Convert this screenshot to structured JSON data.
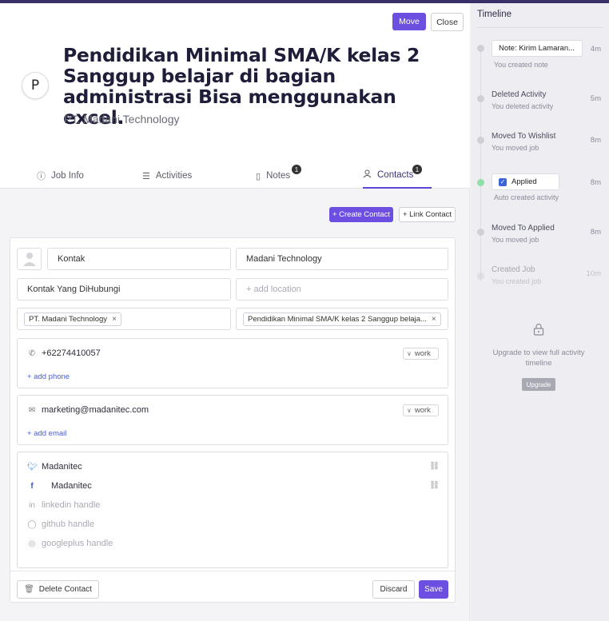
{
  "header": {
    "move_label": "Move",
    "close_label": "Close",
    "avatar_initial": "P",
    "job_title": "Pendidikan Minimal SMA/K kelas 2 Sanggup belajar di bagian administrasi Bisa menggunakan excel.",
    "company": "PT. Madani Technology"
  },
  "tabs": [
    {
      "label": "Job Info",
      "icon": "info-icon"
    },
    {
      "label": "Activities",
      "icon": "list-icon"
    },
    {
      "label": "Notes",
      "icon": "note-icon",
      "badge": "1"
    },
    {
      "label": "Contacts",
      "icon": "contacts-icon",
      "badge": "1",
      "active": true
    }
  ],
  "actions": {
    "create_contact": "+ Create Contact",
    "link_contact": "+ Link Contact"
  },
  "contact": {
    "name": "Kontak",
    "company": "Madani Technology",
    "title": "Kontak Yang DiHubungi",
    "location_placeholder": "+ add location",
    "company_tag": "PT. Madani Technology",
    "job_tag": "Pendidikan Minimal SMA/K kelas 2 Sanggup belaja...",
    "phone": "+62274410057",
    "phone_type": "work",
    "add_phone": "+ add phone",
    "email": "marketing@madanitec.com",
    "email_type": "work",
    "add_email": "+ add email",
    "twitter": "Madanitec",
    "facebook": "Madanitec",
    "linkedin_placeholder": "linkedin handle",
    "github_placeholder": "github handle",
    "googleplus_placeholder": "googleplus handle"
  },
  "footer": {
    "delete_label": "Delete Contact",
    "discard_label": "Discard",
    "save_label": "Save"
  },
  "timeline": {
    "title": "Timeline",
    "events": [
      {
        "card": "Note: Kirim Lamaran...",
        "sub": "You created note",
        "time": "4m"
      },
      {
        "label": "Deleted Activity",
        "sub": "You deleted activity",
        "time": "5m"
      },
      {
        "label": "Moved To Wishlist",
        "sub": "You moved job",
        "time": "8m"
      },
      {
        "card": "Applied",
        "sub": "Auto created activity",
        "time": "8m"
      },
      {
        "label": "Moved To Applied",
        "sub": "You moved job",
        "time": "8m"
      },
      {
        "label": "Created Job",
        "sub": "You created job",
        "time": "10m"
      }
    ],
    "upgrade_text": "Upgrade to view full activity timeline",
    "upgrade_button": "Upgrade"
  },
  "colors": {
    "accent": "#6c4fe0",
    "active_dot": "#8fe0a6"
  }
}
